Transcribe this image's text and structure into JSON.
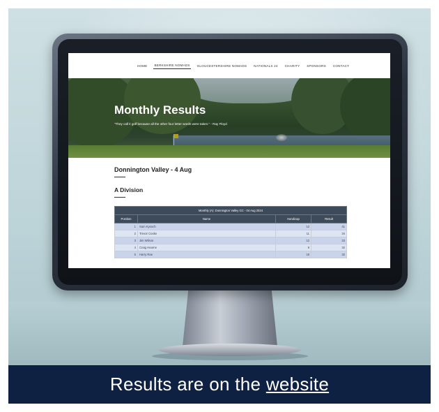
{
  "caption": {
    "text": "Results are on the ",
    "link_text": "website"
  },
  "site": {
    "nav": [
      "HOME",
      "BERKSHIRE NOMADS",
      "GLOUCESTERSHIRE NOMADS",
      "NATIONALS 24",
      "CHARITY",
      "SPONSORS",
      "CONTACT"
    ],
    "active_nav": "BERKSHIRE NOMADS",
    "hero_title": "Monthly Results",
    "hero_quote": "\"They call it golf because all the other four letter words were taken.\" - Ray Floyd",
    "venue_heading": "Donnington Valley - 4 Aug",
    "division_heading": "A Division",
    "table": {
      "title": "Monthly (A): Donnington Valley GC - 04 Aug 2024",
      "headers": [
        "Position",
        "Name",
        "Handicap",
        "Result"
      ],
      "rows": [
        [
          "1",
          "Sam Kynoch",
          "12",
          "41"
        ],
        [
          "2",
          "Trevor Cooke",
          "11",
          "34"
        ],
        [
          "3",
          "Jim Wilson",
          "12",
          "33"
        ],
        [
          "4",
          "Craig Hearne",
          "9",
          "32"
        ],
        [
          "5",
          "Harry Rae",
          "18",
          "32"
        ]
      ]
    }
  },
  "colors": {
    "caption_bg": "#0f2142",
    "table_header": "#3d4a5a",
    "row_odd": "#c9d3e9",
    "row_even": "#dde4f2"
  }
}
